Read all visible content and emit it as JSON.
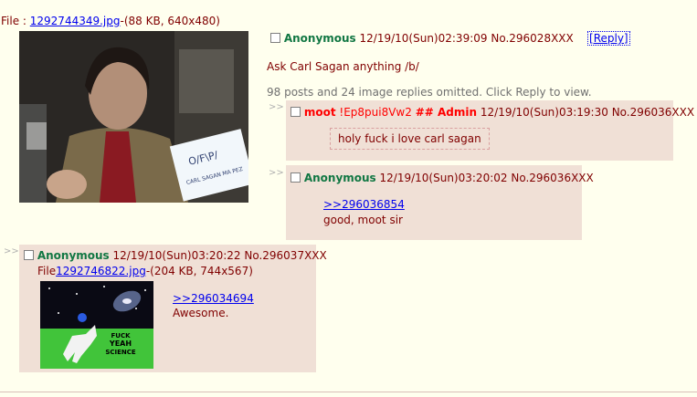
{
  "op": {
    "file_label": "File : ",
    "file_name": "1292744349.jpg",
    "file_info": "-(88 KB, 640x480)",
    "name": "Anonymous",
    "date": "12/19/10(Sun)02:39:09",
    "post_no": "No.296028XXX",
    "reply_link": "[Reply]",
    "message": "Ask Carl Sagan anything /b/",
    "omitted": "98 posts and 24 image replies omitted. Click Reply to view."
  },
  "replies": [
    {
      "name": "moot",
      "tripcode": "!Ep8pui8Vw2",
      "capcode": "## Admin",
      "date": "12/19/10(Sun)03:19:30",
      "post_no": "No.296036XXX",
      "message": "holy fuck i love carl sagan"
    },
    {
      "name": "Anonymous",
      "date": "12/19/10(Sun)03:20:02",
      "post_no": "No.296036XXX",
      "quote": ">>296036854",
      "message": "good, moot sir"
    },
    {
      "name": "Anonymous",
      "date": "12/19/10(Sun)03:20:22",
      "post_no": "No.296037XXX",
      "file_label": "File",
      "file_name": "1292746822.jpg",
      "file_info": "-(204 KB, 744x567)",
      "quote": ">>296034694",
      "message": "Awesome.",
      "image_text": "FUCK YEAH SCIENCE"
    }
  ],
  "reply_arrows": ">>",
  "op_image_sign_text": "O/F\\P/ CARL SAGAN MA PEZ"
}
